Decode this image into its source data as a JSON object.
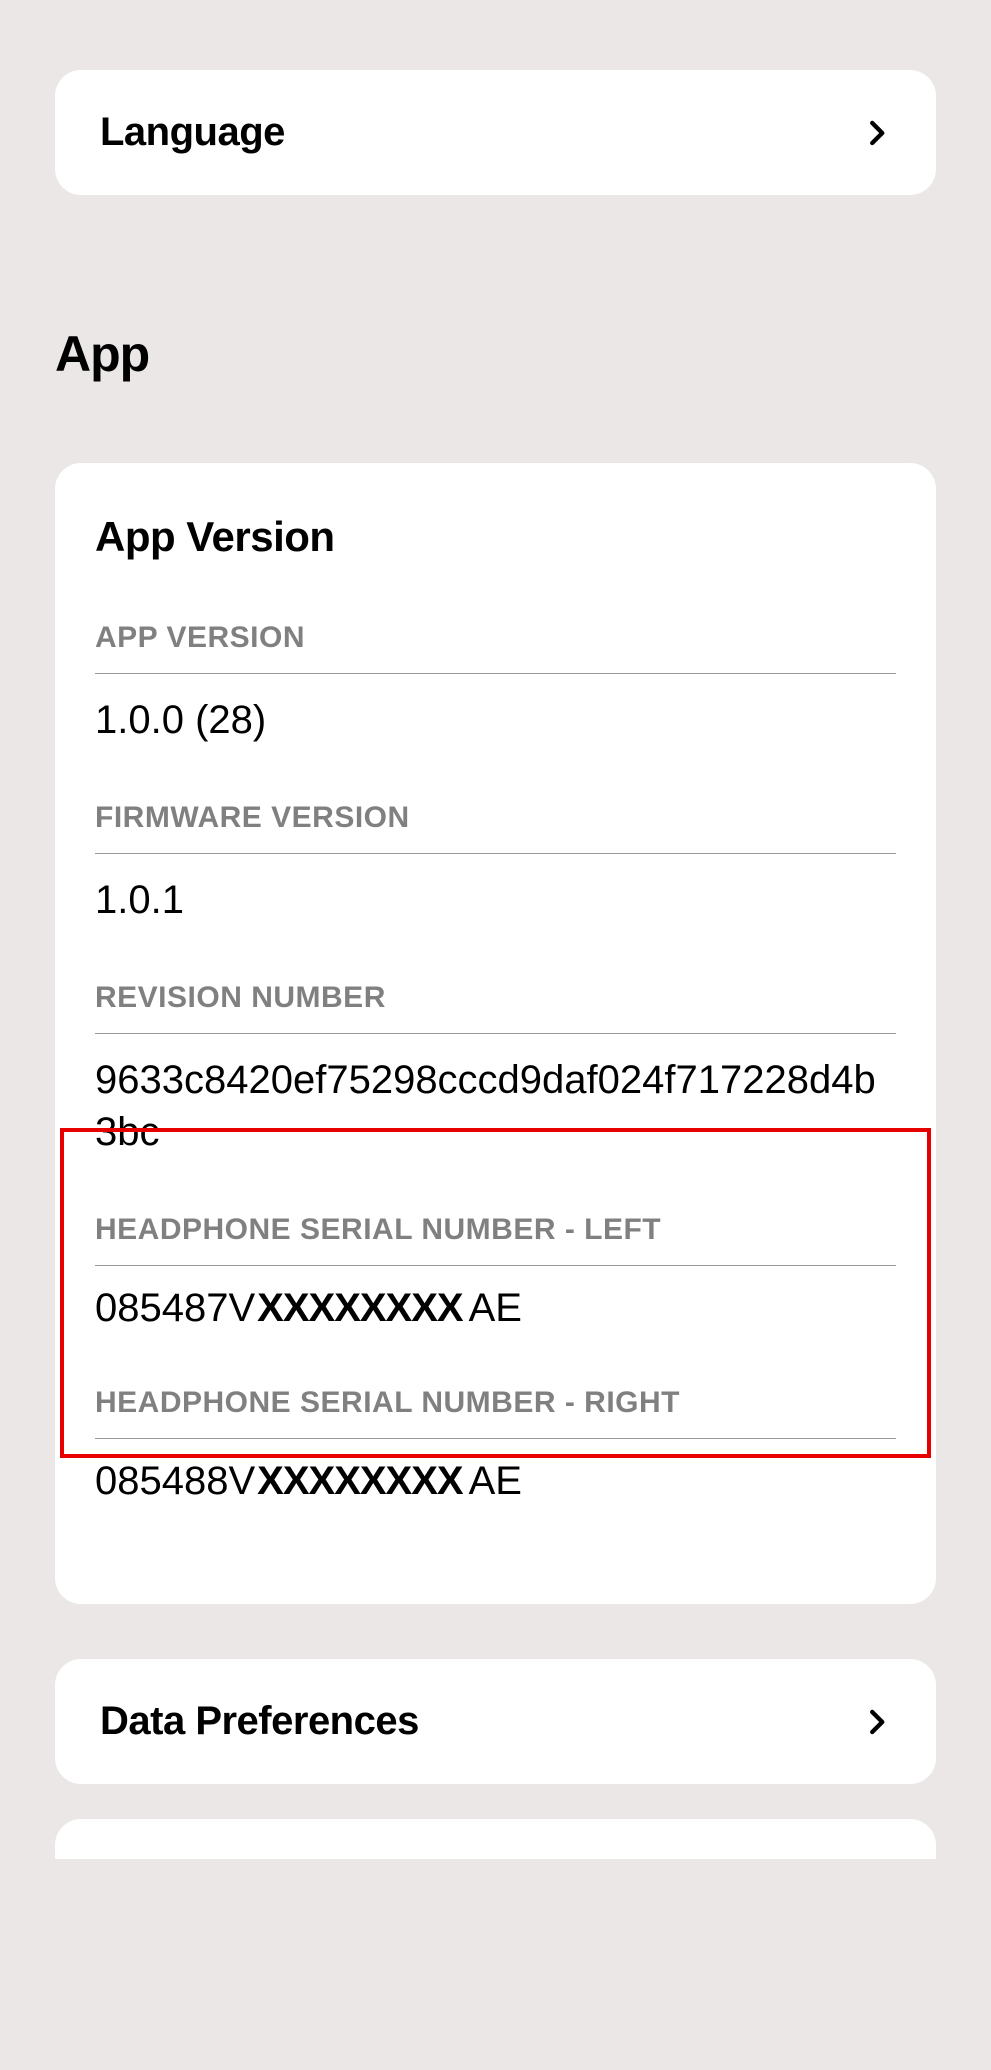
{
  "nav": {
    "language": "Language",
    "dataPreferences": "Data Preferences"
  },
  "section": {
    "app": "App"
  },
  "card": {
    "title": "App Version",
    "items": [
      {
        "label": "APP VERSION",
        "value": "1.0.0 (28)"
      },
      {
        "label": "FIRMWARE VERSION",
        "value": "1.0.1"
      },
      {
        "label": "REVISION NUMBER",
        "value": "9633c8420ef75298cccd9daf024f717228d4b3bc"
      },
      {
        "label": "HEADPHONE SERIAL NUMBER - LEFT",
        "prefix": "085487V",
        "redacted": "XXXXXXXX",
        "suffix": " AE"
      },
      {
        "label": "HEADPHONE SERIAL NUMBER - RIGHT",
        "prefix": "085488V",
        "redacted": "XXXXXXXX",
        "suffix": " AE"
      }
    ]
  }
}
